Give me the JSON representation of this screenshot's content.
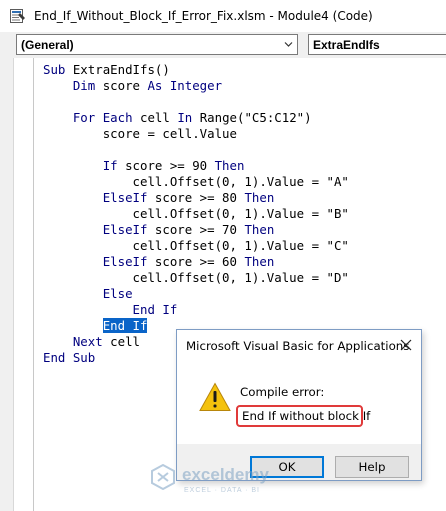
{
  "window": {
    "title": "End_If_Without_Block_If_Error_Fix.xlsm - Module4 (Code)",
    "icon": "vba-module-icon"
  },
  "toolbar": {
    "object_combo": "(General)",
    "procedure_combo": "ExtraEndIfs"
  },
  "code": {
    "lines": [
      {
        "i": 0,
        "tokens": [
          {
            "t": "Sub",
            "kw": true
          },
          {
            "t": " ExtraEndIfs()"
          }
        ]
      },
      {
        "i": 1,
        "tokens": [
          {
            "t": "Dim",
            "kw": true
          },
          {
            "t": " score "
          },
          {
            "t": "As",
            "kw": true
          },
          {
            "t": " "
          },
          {
            "t": "Integer",
            "kw": true
          }
        ]
      },
      {
        "i": 1,
        "tokens": []
      },
      {
        "i": 1,
        "tokens": [
          {
            "t": "For",
            "kw": true
          },
          {
            "t": " "
          },
          {
            "t": "Each",
            "kw": true
          },
          {
            "t": " cell "
          },
          {
            "t": "In",
            "kw": true
          },
          {
            "t": " Range(\"C5:C12\")"
          }
        ]
      },
      {
        "i": 2,
        "tokens": [
          {
            "t": "score = cell.Value"
          }
        ]
      },
      {
        "i": 2,
        "tokens": []
      },
      {
        "i": 2,
        "tokens": [
          {
            "t": "If",
            "kw": true
          },
          {
            "t": " score >= 90 "
          },
          {
            "t": "Then",
            "kw": true
          }
        ]
      },
      {
        "i": 3,
        "tokens": [
          {
            "t": "cell.Offset(0, 1).Value = \"A\""
          }
        ]
      },
      {
        "i": 2,
        "tokens": [
          {
            "t": "ElseIf",
            "kw": true
          },
          {
            "t": " score >= 80 "
          },
          {
            "t": "Then",
            "kw": true
          }
        ]
      },
      {
        "i": 3,
        "tokens": [
          {
            "t": "cell.Offset(0, 1).Value = \"B\""
          }
        ]
      },
      {
        "i": 2,
        "tokens": [
          {
            "t": "ElseIf",
            "kw": true
          },
          {
            "t": " score >= 70 "
          },
          {
            "t": "Then",
            "kw": true
          }
        ]
      },
      {
        "i": 3,
        "tokens": [
          {
            "t": "cell.Offset(0, 1).Value = \"C\""
          }
        ]
      },
      {
        "i": 2,
        "tokens": [
          {
            "t": "ElseIf",
            "kw": true
          },
          {
            "t": " score >= 60 "
          },
          {
            "t": "Then",
            "kw": true
          }
        ]
      },
      {
        "i": 3,
        "tokens": [
          {
            "t": "cell.Offset(0, 1).Value = \"D\""
          }
        ]
      },
      {
        "i": 2,
        "tokens": [
          {
            "t": "Else",
            "kw": true
          }
        ]
      },
      {
        "i": 3,
        "tokens": [
          {
            "t": "End If",
            "kw": true
          }
        ]
      },
      {
        "i": 2,
        "tokens": [
          {
            "t": "End If",
            "sel": true
          }
        ]
      },
      {
        "i": 1,
        "tokens": [
          {
            "t": "Next",
            "kw": true
          },
          {
            "t": " cell"
          }
        ]
      },
      {
        "i": 0,
        "tokens": [
          {
            "t": "End Sub",
            "kw": true
          }
        ]
      }
    ]
  },
  "dialog": {
    "title": "Microsoft Visual Basic for Applications",
    "heading": "Compile error:",
    "message": "End If without block If",
    "ok_label": "OK",
    "help_label": "Help",
    "icon": "warning-icon"
  },
  "watermark": {
    "name": "exceldemy",
    "tagline": "EXCEL · DATA · BI"
  },
  "colors": {
    "keyword": "#00007f",
    "selection": "#0a64c8",
    "error_outline": "#e03a3a",
    "warning": "#f4c20d",
    "ok_focus": "#0078d7"
  }
}
